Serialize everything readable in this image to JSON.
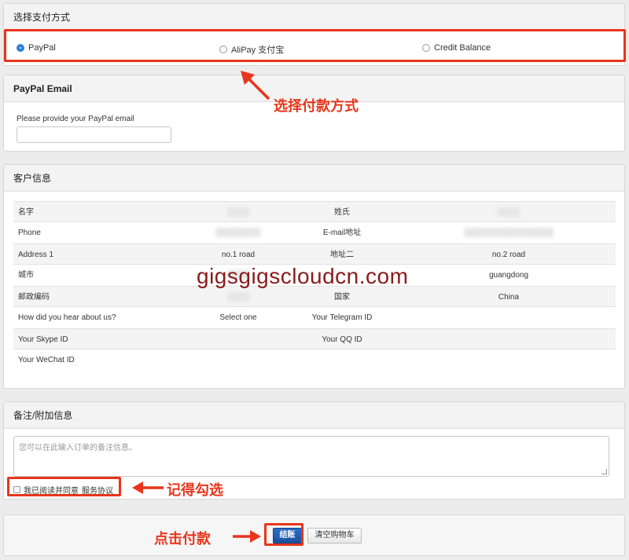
{
  "payment": {
    "heading": "选择支付方式",
    "options": [
      {
        "label": "PayPal",
        "selected": true
      },
      {
        "label": "AliPay 支付宝",
        "selected": false
      },
      {
        "label": "Credit Balance",
        "selected": false
      }
    ]
  },
  "paypal": {
    "heading": "PayPal Email",
    "field_label": "Please provide your PayPal email",
    "email_value": ""
  },
  "customer": {
    "heading": "客户信息",
    "rows": [
      {
        "l1": "名字",
        "v1": "████",
        "l2": "姓氏",
        "v2": "████"
      },
      {
        "l1": "Phone",
        "v1": "████████",
        "l2": "E-mail地址",
        "v2": "████████████████"
      },
      {
        "l1": "Address 1",
        "v1": "no.1 road",
        "l2": "地址二",
        "v2": "no.2 road"
      },
      {
        "l1": "城市",
        "v1": "████",
        "l2": "省份",
        "v2": "guangdong"
      },
      {
        "l1": "邮政编码",
        "v1": "████",
        "l2": "国家",
        "v2": "China"
      },
      {
        "l1": "How did you hear about us?",
        "v1": "Select one",
        "l2": "Your Telegram ID",
        "v2": ""
      },
      {
        "l1": "Your Skype ID",
        "v1": "",
        "l2": "Your QQ ID",
        "v2": ""
      },
      {
        "l1": "Your WeChat ID",
        "v1": "",
        "l2": "",
        "v2": ""
      }
    ]
  },
  "notes": {
    "heading": "备注/附加信息",
    "placeholder": "您可以在此输入订单的备注信息。",
    "agree_text": "我已阅读并同意",
    "agree_link": "服务协议"
  },
  "checkout": {
    "checkout_label": "结账",
    "clear_cart_label": "清空购物车"
  },
  "annotations": {
    "select_payment": "选择付款方式",
    "remember_check": "记得勾选",
    "click_pay": "点击付款"
  },
  "watermark": "gigsgigscloudcn.com",
  "colors": {
    "annotation_red": "#e8351b",
    "primary_blue": "#1b4f9c",
    "watermark": "#8b1a1a"
  }
}
